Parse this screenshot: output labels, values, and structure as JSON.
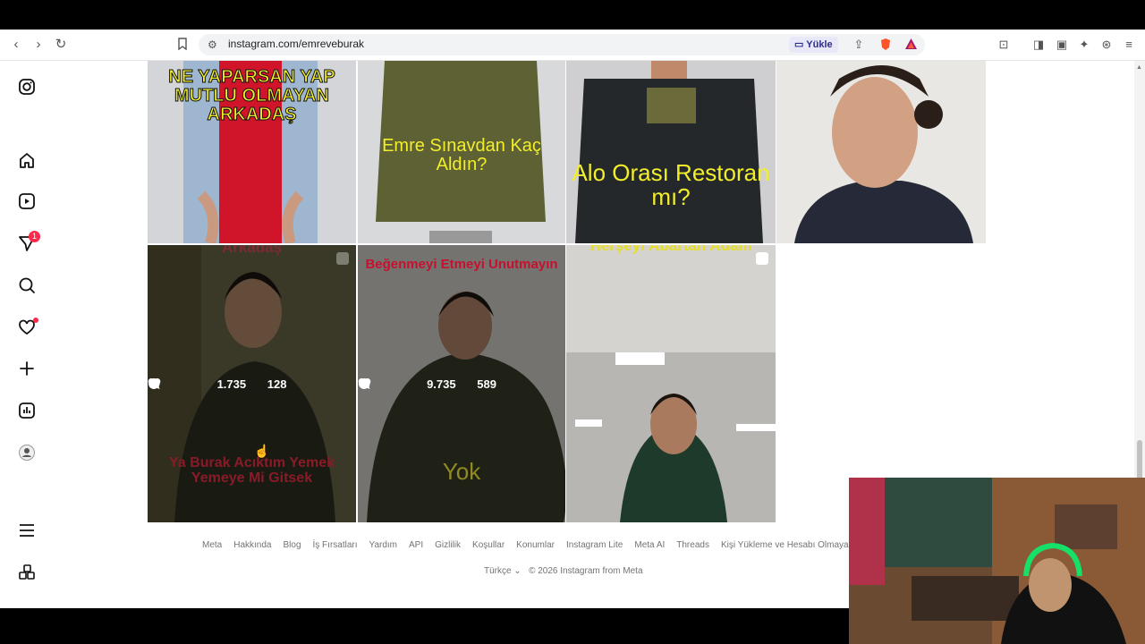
{
  "browser": {
    "url": "instagram.com/emreveburak",
    "upload_label": "Yükle"
  },
  "sidebar": {
    "notification_count": "1"
  },
  "posts": [
    {
      "caption": "NE YAPARSAN YAP MUTLU OLMAYAN ARKADAŞ"
    },
    {
      "caption": "Emre Sınavdan Kaç Aldın?"
    },
    {
      "caption": "Alo Orası Restoran mı?"
    },
    {
      "caption": ""
    },
    {
      "caption_top": "Arkadaş",
      "caption_bottom": "Ya Burak Acıktım Yemek Yemeye Mi Gitsek",
      "likes": "1.735",
      "comments": "128"
    },
    {
      "caption_top": "Beğenmeyi Etmeyi Unutmayın",
      "caption_bottom": "Yok",
      "likes": "9.735",
      "comments": "589"
    },
    {
      "caption_top": "Herşeyi Abartan Adam"
    }
  ],
  "footer": {
    "links": [
      "Meta",
      "Hakkında",
      "Blog",
      "İş Fırsatları",
      "Yardım",
      "API",
      "Gizlilik",
      "Koşullar",
      "Konumlar",
      "Instagram Lite",
      "Meta AI",
      "Threads",
      "Kişi Yükleme ve Hesabı Olmayan K"
    ],
    "language": "Türkçe",
    "copyright": "© 2026 Instagram from Meta"
  },
  "colors": {
    "accent": "#ff2a4b",
    "caption_yellow": "#f2ee2a",
    "caption_red": "#c8102e",
    "footer_text": "#737373"
  }
}
